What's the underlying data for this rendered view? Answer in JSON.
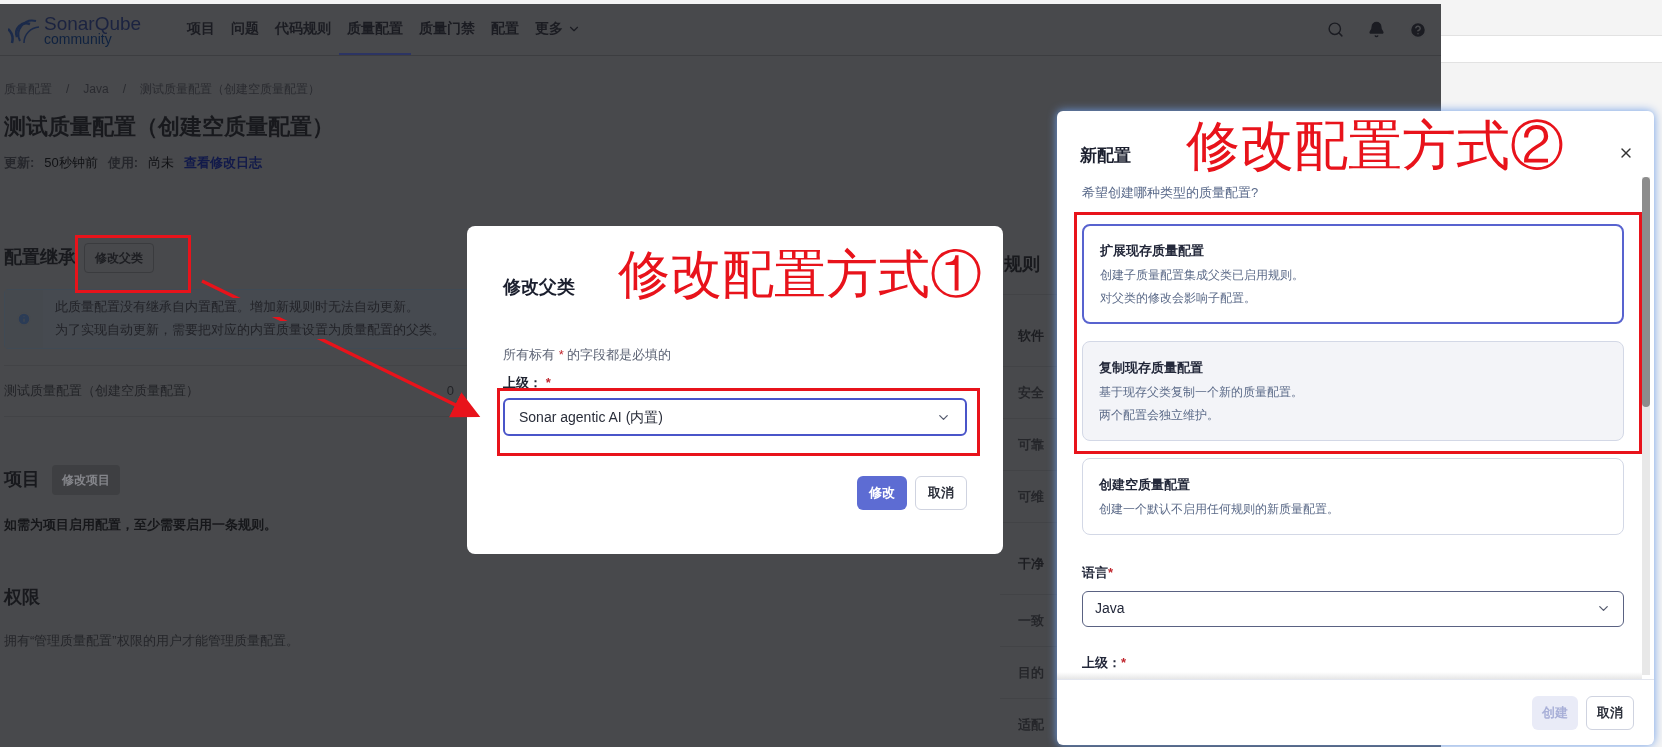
{
  "nav": {
    "logo_top": "SonarQube",
    "logo_bottom": "community",
    "items": [
      {
        "label": "项目",
        "selected": false,
        "dropdown": false
      },
      {
        "label": "问题",
        "selected": false,
        "dropdown": false
      },
      {
        "label": "代码规则",
        "selected": false,
        "dropdown": false
      },
      {
        "label": "质量配置",
        "selected": true,
        "dropdown": false
      },
      {
        "label": "质量门禁",
        "selected": false,
        "dropdown": false
      },
      {
        "label": "配置",
        "selected": false,
        "dropdown": false
      },
      {
        "label": "更多",
        "selected": false,
        "dropdown": true
      }
    ]
  },
  "breadcrumb": [
    "质量配置",
    "Java",
    "测试质量配置（创建空质量配置）"
  ],
  "breadcrumb_separator": "/",
  "page_title": "测试质量配置（创建空质量配置）",
  "meta": [
    {
      "label": "更新:",
      "value": "50秒钟前"
    },
    {
      "label": "使用:",
      "value": "尚未"
    }
  ],
  "changelog_link": "查看修改日志",
  "inheritance": {
    "heading": "配置继承",
    "button": "修改父类",
    "info": [
      "此质量配置没有继承自内置配置。增加新规则时无法自动更新。",
      "为了实现自动更新，需要把对应的内置质量设置为质量配置的父类。"
    ],
    "row_name": "测试质量配置（创建空质量配置）",
    "row_count": "0"
  },
  "projects": {
    "heading": "项目",
    "button": "修改项目",
    "button_disabled": true,
    "note": "如需为项目启用配置，至少需要启用一条规则。"
  },
  "permissions": {
    "heading": "权限",
    "note": "拥有“管理质量配置”权限的用户才能管理质量配置。"
  },
  "rules_panel": {
    "heading": "规则",
    "rows": [
      {
        "label": "软件",
        "kind": "header"
      },
      {
        "label": "安全",
        "kind": "item"
      },
      {
        "label": "可靠",
        "kind": "item"
      },
      {
        "label": "可维",
        "kind": "item"
      },
      {
        "label": "干净",
        "kind": "header"
      },
      {
        "label": "一致",
        "kind": "item"
      },
      {
        "label": "目的",
        "kind": "item"
      },
      {
        "label": "适配",
        "kind": "item"
      }
    ]
  },
  "dialog_parent": {
    "title": "修改父类",
    "required_before": "所有标有",
    "required_mark": "*",
    "required_after": "的字段都是必填的",
    "field_label": "上级：",
    "field_mark": "*",
    "field_value": "Sonar agentic AI (内置)",
    "buttons": [
      {
        "label": "修改",
        "kind": "primary"
      },
      {
        "label": "取消",
        "kind": "secondary"
      }
    ]
  },
  "dialog_new": {
    "title": "新配置",
    "subtitle": "希望创建哪种类型的质量配置?",
    "options": [
      {
        "title": "扩展现存质量配置",
        "lines": [
          "创建子质量配置集成父类已启用规则。",
          "对父类的修改会影响子配置。"
        ],
        "selected": true,
        "hovered": false
      },
      {
        "title": "复制现存质量配置",
        "lines": [
          "基于现存父类复制一个新的质量配置。",
          "两个配置会独立维护。"
        ],
        "selected": false,
        "hovered": true
      },
      {
        "title": "创建空质量配置",
        "lines": [
          "创建一个默认不启用任何规则的新质量配置。"
        ],
        "selected": false,
        "hovered": false
      }
    ],
    "language_label": "语言",
    "language_mark": "*",
    "language_value": "Java",
    "parent_label": "上级：",
    "parent_mark": "*",
    "buttons": [
      {
        "label": "创建",
        "kind": "primary",
        "disabled": true
      },
      {
        "label": "取消",
        "kind": "secondary",
        "disabled": false
      }
    ]
  },
  "annotations": {
    "label_1": "修改配置方式①",
    "label_2": "修改配置方式②"
  }
}
